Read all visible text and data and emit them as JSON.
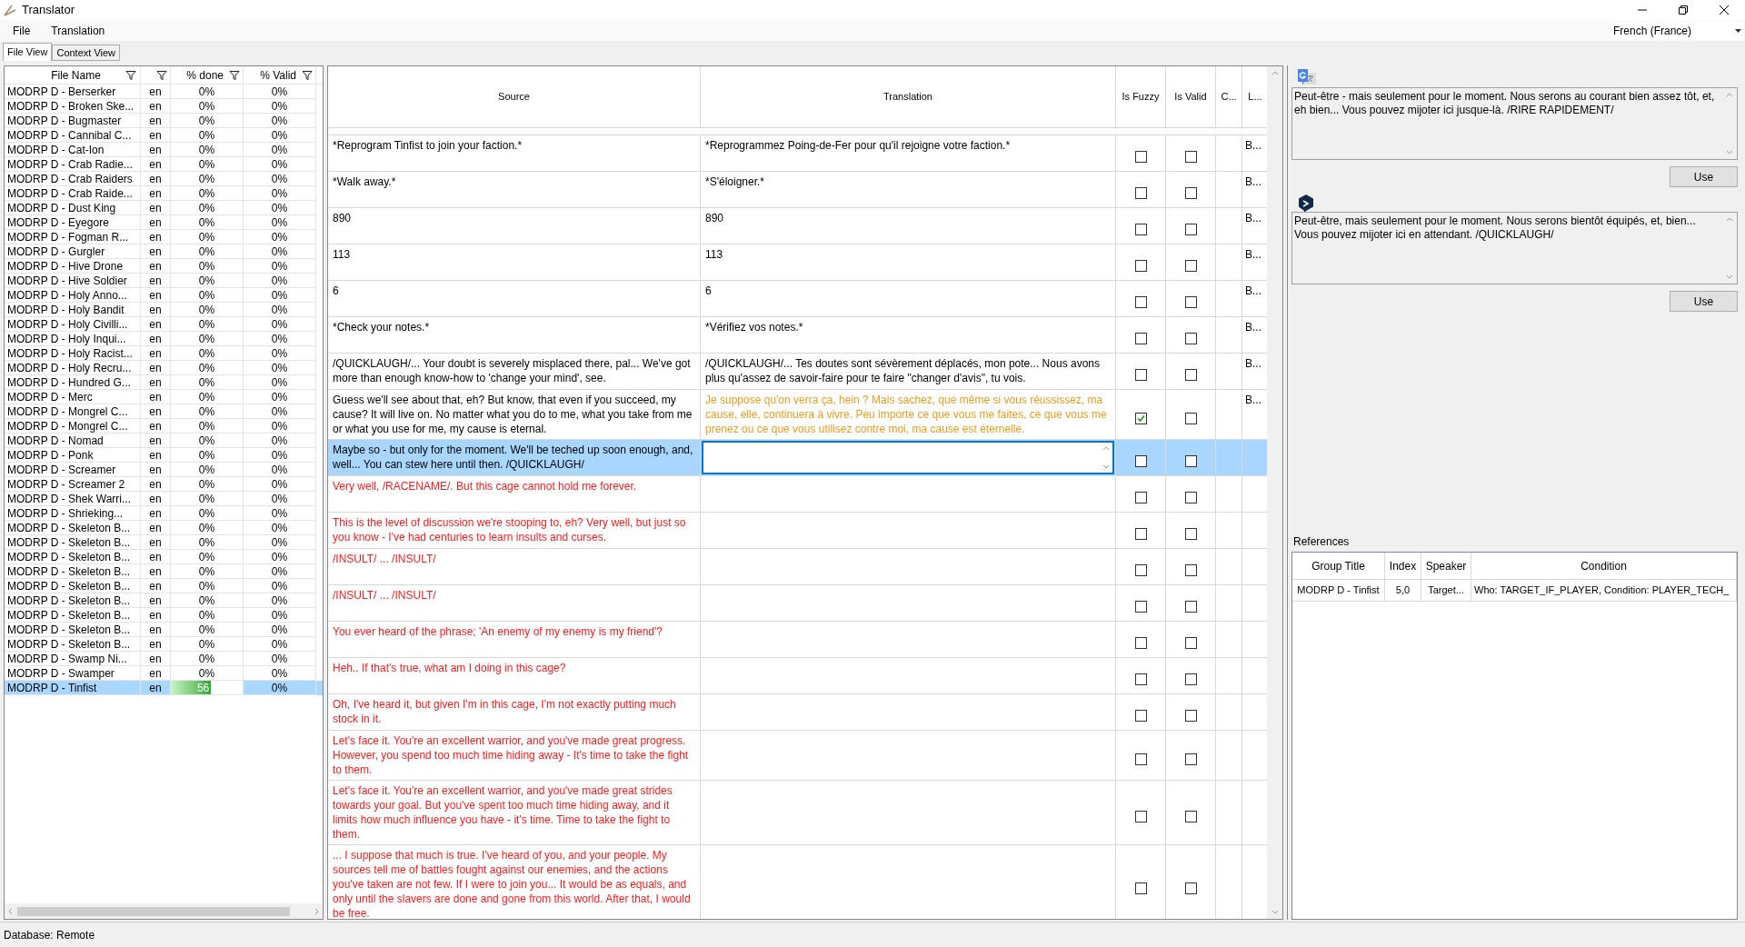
{
  "window": {
    "title": "Translator"
  },
  "menu": [
    "File",
    "Translation"
  ],
  "language": {
    "value": "French (France)"
  },
  "view_tabs": [
    {
      "label": "File View",
      "selected": true
    },
    {
      "label": "Context View",
      "selected": false
    }
  ],
  "files": {
    "columns": [
      "File Name",
      "% done",
      "% Valid"
    ],
    "rows": [
      {
        "name": "MODRP D - Berserker",
        "lang": "en",
        "done": "0%",
        "valid": "0%",
        "selected": false
      },
      {
        "name": "MODRP D - Broken Ske...",
        "lang": "en",
        "done": "0%",
        "valid": "0%",
        "selected": false
      },
      {
        "name": "MODRP D - Bugmaster",
        "lang": "en",
        "done": "0%",
        "valid": "0%",
        "selected": false
      },
      {
        "name": "MODRP D - Cannibal C...",
        "lang": "en",
        "done": "0%",
        "valid": "0%",
        "selected": false
      },
      {
        "name": "MODRP D - Cat-Ion",
        "lang": "en",
        "done": "0%",
        "valid": "0%",
        "selected": false
      },
      {
        "name": "MODRP D - Crab Radie...",
        "lang": "en",
        "done": "0%",
        "valid": "0%",
        "selected": false
      },
      {
        "name": "MODRP D - Crab Raiders",
        "lang": "en",
        "done": "0%",
        "valid": "0%",
        "selected": false
      },
      {
        "name": "MODRP D - Crab Raide...",
        "lang": "en",
        "done": "0%",
        "valid": "0%",
        "selected": false
      },
      {
        "name": "MODRP D - Dust King",
        "lang": "en",
        "done": "0%",
        "valid": "0%",
        "selected": false
      },
      {
        "name": "MODRP D - Eyegore",
        "lang": "en",
        "done": "0%",
        "valid": "0%",
        "selected": false
      },
      {
        "name": "MODRP D - Fogman R...",
        "lang": "en",
        "done": "0%",
        "valid": "0%",
        "selected": false
      },
      {
        "name": "MODRP D - Gurgler",
        "lang": "en",
        "done": "0%",
        "valid": "0%",
        "selected": false
      },
      {
        "name": "MODRP D - Hive Drone",
        "lang": "en",
        "done": "0%",
        "valid": "0%",
        "selected": false
      },
      {
        "name": "MODRP D - Hive Soldier",
        "lang": "en",
        "done": "0%",
        "valid": "0%",
        "selected": false
      },
      {
        "name": "MODRP D - Holy Anno...",
        "lang": "en",
        "done": "0%",
        "valid": "0%",
        "selected": false
      },
      {
        "name": "MODRP D - Holy Bandit",
        "lang": "en",
        "done": "0%",
        "valid": "0%",
        "selected": false
      },
      {
        "name": "MODRP D - Holy Civilli...",
        "lang": "en",
        "done": "0%",
        "valid": "0%",
        "selected": false
      },
      {
        "name": "MODRP D - Holy Inqui...",
        "lang": "en",
        "done": "0%",
        "valid": "0%",
        "selected": false
      },
      {
        "name": "MODRP D - Holy Racist...",
        "lang": "en",
        "done": "0%",
        "valid": "0%",
        "selected": false
      },
      {
        "name": "MODRP D - Holy Recru...",
        "lang": "en",
        "done": "0%",
        "valid": "0%",
        "selected": false
      },
      {
        "name": "MODRP D - Hundred G...",
        "lang": "en",
        "done": "0%",
        "valid": "0%",
        "selected": false
      },
      {
        "name": "MODRP D - Merc",
        "lang": "en",
        "done": "0%",
        "valid": "0%",
        "selected": false
      },
      {
        "name": "MODRP D - Mongrel C...",
        "lang": "en",
        "done": "0%",
        "valid": "0%",
        "selected": false
      },
      {
        "name": "MODRP D - Mongrel C...",
        "lang": "en",
        "done": "0%",
        "valid": "0%",
        "selected": false
      },
      {
        "name": "MODRP D - Nomad",
        "lang": "en",
        "done": "0%",
        "valid": "0%",
        "selected": false
      },
      {
        "name": "MODRP D - Ponk",
        "lang": "en",
        "done": "0%",
        "valid": "0%",
        "selected": false
      },
      {
        "name": "MODRP D - Screamer",
        "lang": "en",
        "done": "0%",
        "valid": "0%",
        "selected": false
      },
      {
        "name": "MODRP D - Screamer 2",
        "lang": "en",
        "done": "0%",
        "valid": "0%",
        "selected": false
      },
      {
        "name": "MODRP D - Shek Warri...",
        "lang": "en",
        "done": "0%",
        "valid": "0%",
        "selected": false
      },
      {
        "name": "MODRP D - Shrieking...",
        "lang": "en",
        "done": "0%",
        "valid": "0%",
        "selected": false
      },
      {
        "name": "MODRP D - Skeleton B...",
        "lang": "en",
        "done": "0%",
        "valid": "0%",
        "selected": false
      },
      {
        "name": "MODRP D - Skeleton B...",
        "lang": "en",
        "done": "0%",
        "valid": "0%",
        "selected": false
      },
      {
        "name": "MODRP D - Skeleton B...",
        "lang": "en",
        "done": "0%",
        "valid": "0%",
        "selected": false
      },
      {
        "name": "MODRP D - Skeleton B...",
        "lang": "en",
        "done": "0%",
        "valid": "0%",
        "selected": false
      },
      {
        "name": "MODRP D - Skeleton B...",
        "lang": "en",
        "done": "0%",
        "valid": "0%",
        "selected": false
      },
      {
        "name": "MODRP D - Skeleton B...",
        "lang": "en",
        "done": "0%",
        "valid": "0%",
        "selected": false
      },
      {
        "name": "MODRP D - Skeleton B...",
        "lang": "en",
        "done": "0%",
        "valid": "0%",
        "selected": false
      },
      {
        "name": "MODRP D - Skeleton B...",
        "lang": "en",
        "done": "0%",
        "valid": "0%",
        "selected": false
      },
      {
        "name": "MODRP D - Skeleton B...",
        "lang": "en",
        "done": "0%",
        "valid": "0%",
        "selected": false
      },
      {
        "name": "MODRP D - Swamp Ni...",
        "lang": "en",
        "done": "0%",
        "valid": "0%",
        "selected": false
      },
      {
        "name": "MODRP D - Swamper",
        "lang": "en",
        "done": "0%",
        "valid": "0%",
        "selected": false
      },
      {
        "name": "MODRP D - Tinfist",
        "lang": "en",
        "done": "56",
        "level": 0.56,
        "valid": "0%",
        "selected": true
      }
    ]
  },
  "grid": {
    "columns": [
      "Source",
      "Translation",
      "Is Fuzzy",
      "Is Valid",
      "C...",
      "L..."
    ],
    "rows": [
      {
        "kind": "done",
        "source": "*Reprogram Tinfist to join your faction.*",
        "translation": "*Reprogrammez Poing-de-Fer pour qu'il rejoigne votre faction.*",
        "fuzzy": false,
        "valid": false,
        "column_6": "B...",
        "selected": false
      },
      {
        "kind": "done",
        "source": "*Walk away.*",
        "translation": "*S'éloigner.*",
        "fuzzy": false,
        "valid": false,
        "column_6": "B...",
        "selected": false
      },
      {
        "kind": "done",
        "source": "890",
        "translation": "890",
        "fuzzy": false,
        "valid": false,
        "column_6": "B...",
        "selected": false
      },
      {
        "kind": "done",
        "source": "113",
        "translation": "113",
        "fuzzy": false,
        "valid": false,
        "column_6": "B...",
        "selected": false
      },
      {
        "kind": "done",
        "source": "6",
        "translation": "6",
        "fuzzy": false,
        "valid": false,
        "column_6": "B...",
        "selected": false
      },
      {
        "kind": "done",
        "source": "*Check your notes.*",
        "translation": "*Vérifiez vos notes.*",
        "fuzzy": false,
        "valid": false,
        "column_6": "B...",
        "selected": false
      },
      {
        "kind": "done",
        "source": "/QUICKLAUGH/... Your doubt is severely misplaced there, pal... We've got more than enough know-how to 'change your mind', see.",
        "translation": "/QUICKLAUGH/... Tes doutes sont sévèrement déplacés, mon pote... Nous avons plus qu'assez de savoir-faire pour te faire \"changer d'avis\", tu vois.",
        "fuzzy": false,
        "valid": false,
        "column_6": "B...",
        "selected": false
      },
      {
        "kind": "fuzzy",
        "source": "Guess we'll see about that, eh? But know, that even if you succeed, my cause? It will live on. No matter what you do to me, what you take from me or what you use for me, my cause is eternal.",
        "translation": "Je suppose qu'on verra ça, hein ? Mais sachez, que même si vous réussissez, ma cause, elle, continuera à vivre. Peu importe ce que vous me faites, ce que vous me prenez ou ce que vous utilisez contre moi, ma cause est éternelle.",
        "fuzzy": true,
        "valid": false,
        "column_6": "B...",
        "selected": false
      },
      {
        "kind": "editing",
        "source": "Maybe so - but only for the moment. We'll be teched up soon enough, and, well... You can stew here until then. /QUICKLAUGH/",
        "fuzzy": false,
        "valid": false,
        "selected": true
      },
      {
        "kind": "missing",
        "source": "Very well, /RACENAME/. But this cage cannot hold me forever.",
        "fuzzy": false,
        "valid": false,
        "selected": false
      },
      {
        "kind": "missing",
        "source": "This is the level of discussion we're stooping to, eh? Very well, but just so you know - I've had centuries to learn insults and curses.",
        "fuzzy": false,
        "valid": false,
        "selected": false
      },
      {
        "kind": "missing",
        "source": "/INSULT/ ... /INSULT/",
        "fuzzy": false,
        "valid": false,
        "selected": false
      },
      {
        "kind": "missing",
        "source": "/INSULT/ ... /INSULT/",
        "fuzzy": false,
        "valid": false,
        "selected": false
      },
      {
        "kind": "missing",
        "source": "You ever heard of the phrase; 'An enemy of my enemy is my friend'?",
        "fuzzy": false,
        "valid": false,
        "selected": false
      },
      {
        "kind": "missing",
        "source": "Heh.. If that's true, what am I doing in this cage?",
        "fuzzy": false,
        "valid": false,
        "selected": false
      },
      {
        "kind": "missing",
        "source": "Oh, I've heard it, but given I'm in this cage, I'm not exactly putting much stock in it.",
        "fuzzy": false,
        "valid": false,
        "selected": false
      },
      {
        "kind": "missing",
        "source": "Let's face it. You're an excellent warrior, and you've made great progress. However, you spend too much time hiding away - It's time to take the fight to them.",
        "fuzzy": false,
        "valid": false,
        "selected": false
      },
      {
        "kind": "missing",
        "source": "Let's face it. You're an excellent warrior, and you've made great strides towards your goal. But you've spent too much time hiding away, and it limits how much influence you have - it's time. Time to take the fight to them.",
        "fuzzy": false,
        "valid": false,
        "selected": false
      },
      {
        "kind": "missing",
        "source": "... I suppose that much is true. I've heard of you, and your people. My sources tell me of battles fought against our enemies, and the actions you've taken are not few. If I were to join you... It would be as equals, and only until the slavers are done and gone from this world. After that, I would be free.",
        "fuzzy": false,
        "valid": false,
        "selected": false
      }
    ]
  },
  "suggestions": [
    {
      "kind": "google",
      "text": "Peut-être - mais seulement pour le moment. Nous serons au courant bien assez tôt, et, eh bien... Vous pouvez mijoter ici jusque-là. /RIRE RAPIDEMENT/",
      "button": "Use"
    },
    {
      "kind": "deepl",
      "text": "Peut-être, mais seulement pour le moment. Nous serons bientôt équipés, et, bien... Vous pouvez mijoter ici en attendant. /QUICKLAUGH/",
      "button": "Use"
    }
  ],
  "references": {
    "label": "References",
    "columns": [
      "Group Title",
      "Index",
      "Speaker",
      "Condition"
    ],
    "rows": [
      [
        "MODRP D - Tinfist",
        "5,0",
        "Target...",
        "Who: TARGET_IF_PLAYER, Condition: PLAYER_TECH_"
      ]
    ]
  },
  "status_bar": "Database: Remote"
}
